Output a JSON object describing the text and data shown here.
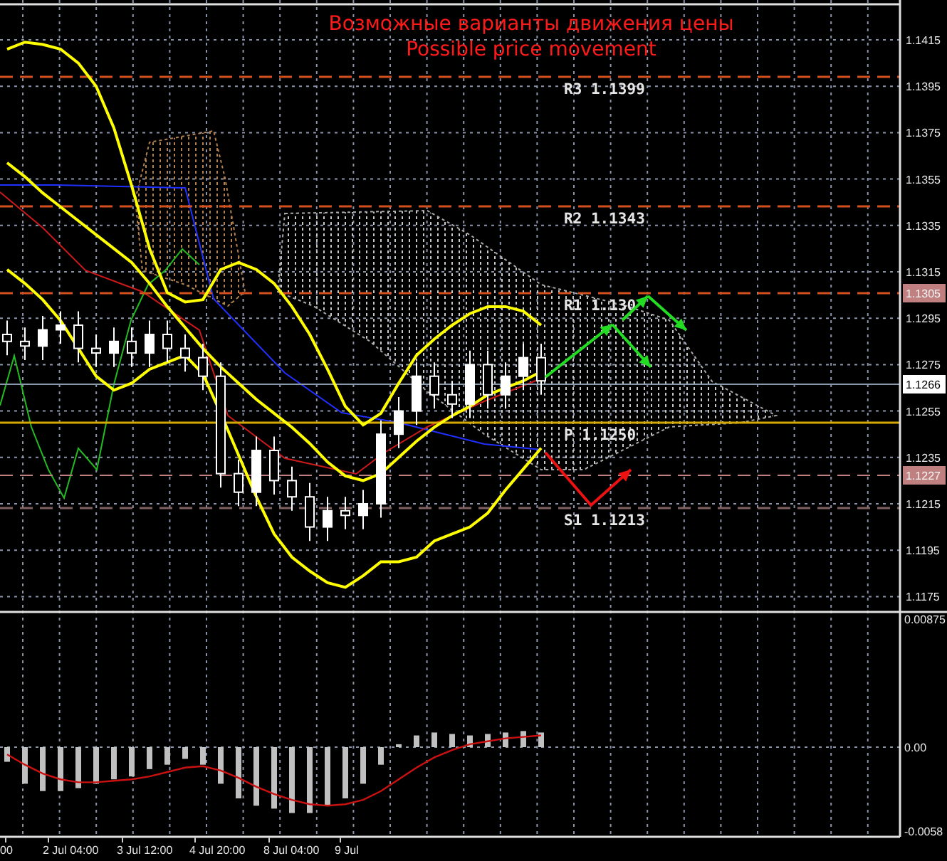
{
  "chart_title": [
    "Возможные варианты движения цены",
    "Possible price movement"
  ],
  "price_axis": [
    "1.1415",
    "1.1395",
    "1.1375",
    "1.1355",
    "1.1335",
    "1.1315",
    "1.1295",
    "1.1275",
    "1.1255",
    "1.1235",
    "1.1215",
    "1.1195",
    "1.1175"
  ],
  "levels": [
    {
      "label": "R3 1.1399"
    },
    {
      "label": "R2 1.1343"
    },
    {
      "label": "R1 1.130"
    },
    {
      "label": "P 1.1250"
    },
    {
      "label": "S1 1.1213"
    }
  ],
  "price_tags": [
    {
      "text": "1.1305",
      "kind": "level"
    },
    {
      "text": "1.1266",
      "kind": "current"
    },
    {
      "text": "1.1227",
      "kind": "level"
    }
  ],
  "oscillator_axis": [
    "0.00875",
    "0.00",
    "-0.0058"
  ],
  "time_axis": [
    "00",
    "2 Jul 04:00",
    "3 Jul 12:00",
    "4 Jul 20:00",
    "8 Jul 04:00",
    "9 Jul"
  ]
}
